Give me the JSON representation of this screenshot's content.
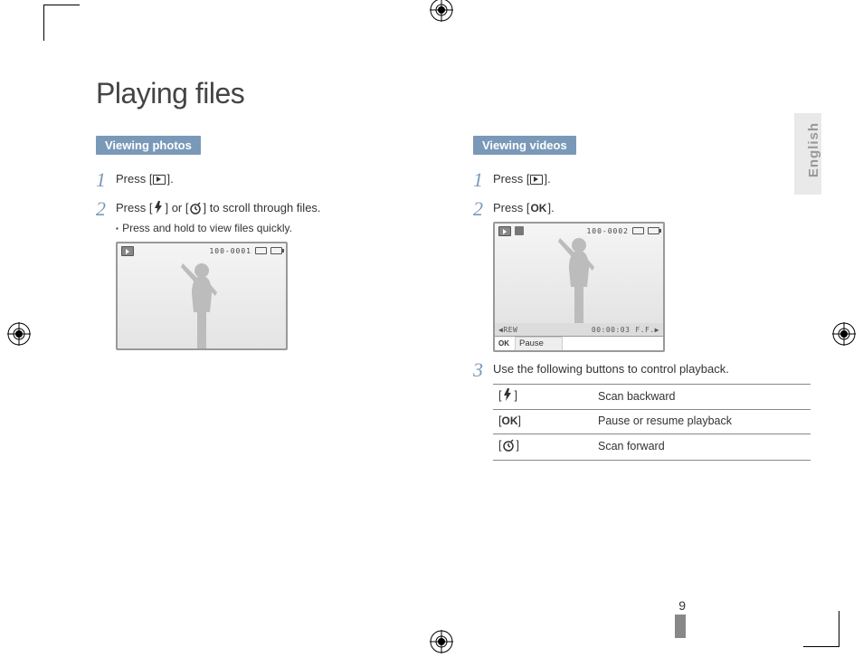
{
  "page_title": "Playing files",
  "language_tab": "English",
  "page_number": "9",
  "photos": {
    "header": "Viewing photos",
    "steps": [
      {
        "num": "1",
        "text_a": "Press [",
        "text_b": "]."
      },
      {
        "num": "2",
        "text_a": "Press [",
        "text_mid": "] or [",
        "text_b": "] to scroll through files.",
        "sub": "Press and hold to view files quickly."
      }
    ],
    "screen": {
      "counter": "100-0001"
    }
  },
  "videos": {
    "header": "Viewing videos",
    "steps": [
      {
        "num": "1",
        "text_a": "Press [",
        "text_b": "]."
      },
      {
        "num": "2",
        "text_a": "Press [",
        "text_b": "]."
      },
      {
        "num": "3",
        "text": "Use the following buttons to control playback."
      }
    ],
    "screen": {
      "counter": "100-0002",
      "time": "00:00:03",
      "rew": "REW",
      "ff": "F.F.",
      "ok": "OK",
      "pause_label": "Pause"
    },
    "controls": [
      {
        "icon": "flash",
        "label": "Scan backward"
      },
      {
        "icon": "ok",
        "label": "Pause or resume playback"
      },
      {
        "icon": "timer",
        "label": "Scan forward"
      }
    ]
  }
}
